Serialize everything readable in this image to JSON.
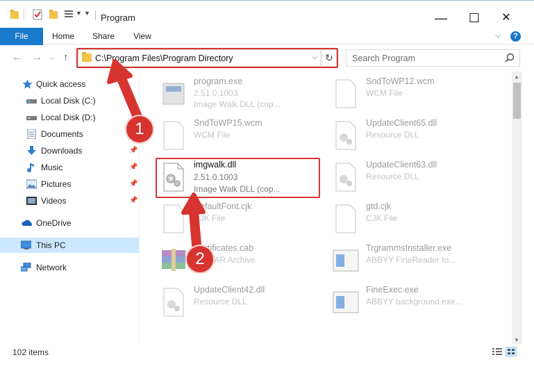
{
  "window": {
    "title": "Program",
    "minimize": "—",
    "maximize": "☐",
    "close": "✕"
  },
  "ribbon": {
    "tabs": [
      "File",
      "Home",
      "Share",
      "View"
    ],
    "help": "?"
  },
  "address": {
    "path": "C:\\Program Files\\Program Directory",
    "dropdown": "⌵",
    "refresh": "↻"
  },
  "search": {
    "placeholder": "Search Program"
  },
  "sidebar": {
    "items": [
      {
        "label": "Quick access",
        "icon": "star-icon",
        "pinned": false
      },
      {
        "label": "Local Disk (C:)",
        "icon": "drive-icon",
        "pinned": false
      },
      {
        "label": "Local Disk (D:)",
        "icon": "drive-icon",
        "pinned": false
      },
      {
        "label": "Documents",
        "icon": "documents-icon",
        "pinned": true
      },
      {
        "label": "Downloads",
        "icon": "downloads-icon",
        "pinned": true
      },
      {
        "label": "Music",
        "icon": "music-icon",
        "pinned": true
      },
      {
        "label": "Pictures",
        "icon": "pictures-icon",
        "pinned": true
      },
      {
        "label": "Videos",
        "icon": "videos-icon",
        "pinned": true
      },
      {
        "label": "OneDrive",
        "icon": "onedrive-icon",
        "pinned": false
      },
      {
        "label": "This PC",
        "icon": "computer-icon",
        "pinned": false,
        "selected": true
      },
      {
        "label": "Network",
        "icon": "network-icon",
        "pinned": false
      }
    ],
    "pin_glyph": "📌"
  },
  "files": [
    {
      "name": "program.exe",
      "meta1": "2.51.0.1003",
      "meta2": "Image Walk DLL (cop...",
      "icon": "exe-icon"
    },
    {
      "name": "SndToWP12.wcm",
      "meta1": "WCM File",
      "meta2": "",
      "icon": "generic-file-icon"
    },
    {
      "name": "SndToWP15.wcm",
      "meta1": "WCM File",
      "meta2": "",
      "icon": "generic-file-icon"
    },
    {
      "name": "UpdateClient65.dll",
      "meta1": "Resource DLL",
      "meta2": "",
      "icon": "dll-icon"
    },
    {
      "name": "imgwalk.dll",
      "meta1": "2.51.0.1003",
      "meta2": "Image Walk DLL (cop...",
      "icon": "dll-icon"
    },
    {
      "name": "UpdateClient63.dll",
      "meta1": "Resource DLL",
      "meta2": "",
      "icon": "dll-icon"
    },
    {
      "name": "DefaultFont.cjk",
      "meta1": "CJK File",
      "meta2": "",
      "icon": "generic-file-icon"
    },
    {
      "name": "gtd.cjk",
      "meta1": "CJK File",
      "meta2": "",
      "icon": "generic-file-icon"
    },
    {
      "name": "Certificates.cab",
      "meta1": "WinRAR Archive",
      "meta2": "",
      "icon": "winrar-icon"
    },
    {
      "name": "TrgrammsInstaller.exe",
      "meta1": "ABBYY FineReader fo...",
      "meta2": "",
      "icon": "app-icon"
    },
    {
      "name": "UpdateClient42.dll",
      "meta1": "Resource DLL",
      "meta2": "",
      "icon": "dll-icon"
    },
    {
      "name": "FineExec.exe",
      "meta1": "ABBYY background exe...",
      "meta2": "",
      "icon": "app-icon"
    }
  ],
  "status": {
    "item_count": "102 items"
  },
  "callouts": {
    "step1": "1",
    "step2": "2"
  },
  "colors": {
    "accent": "#1979ca",
    "highlight": "#d7332f",
    "selected": "#cce8ff"
  }
}
